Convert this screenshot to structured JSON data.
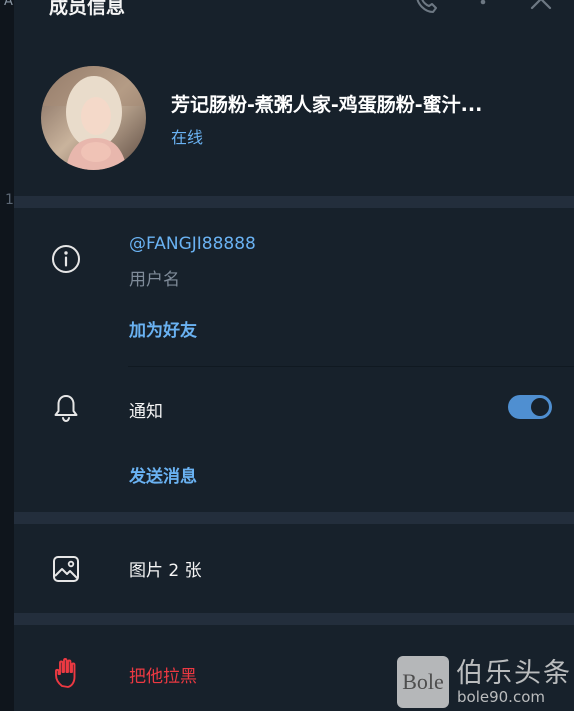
{
  "header": {
    "title": "成员信息",
    "background_partial_text": "A",
    "background_partial_number": "1"
  },
  "profile": {
    "name": "芳记肠粉-煮粥人家-鸡蛋肠粉-蜜汁...",
    "status": "在线"
  },
  "info": {
    "username": "@FANGJI88888",
    "username_label": "用户名",
    "add_friend": "加为好友"
  },
  "notifications": {
    "label": "通知",
    "enabled": true,
    "send_message": "发送消息"
  },
  "media": {
    "label": "图片 2 张"
  },
  "actions": {
    "block": "把他拉黑"
  },
  "watermark": {
    "logo_text": "Bole",
    "name": "伯乐头条",
    "url": "bole90.com"
  },
  "colors": {
    "panel": "#17212b",
    "separator": "#232e3c",
    "accent": "#6ab2f2",
    "danger": "#ec3942",
    "toggle": "#4f8fd1"
  }
}
